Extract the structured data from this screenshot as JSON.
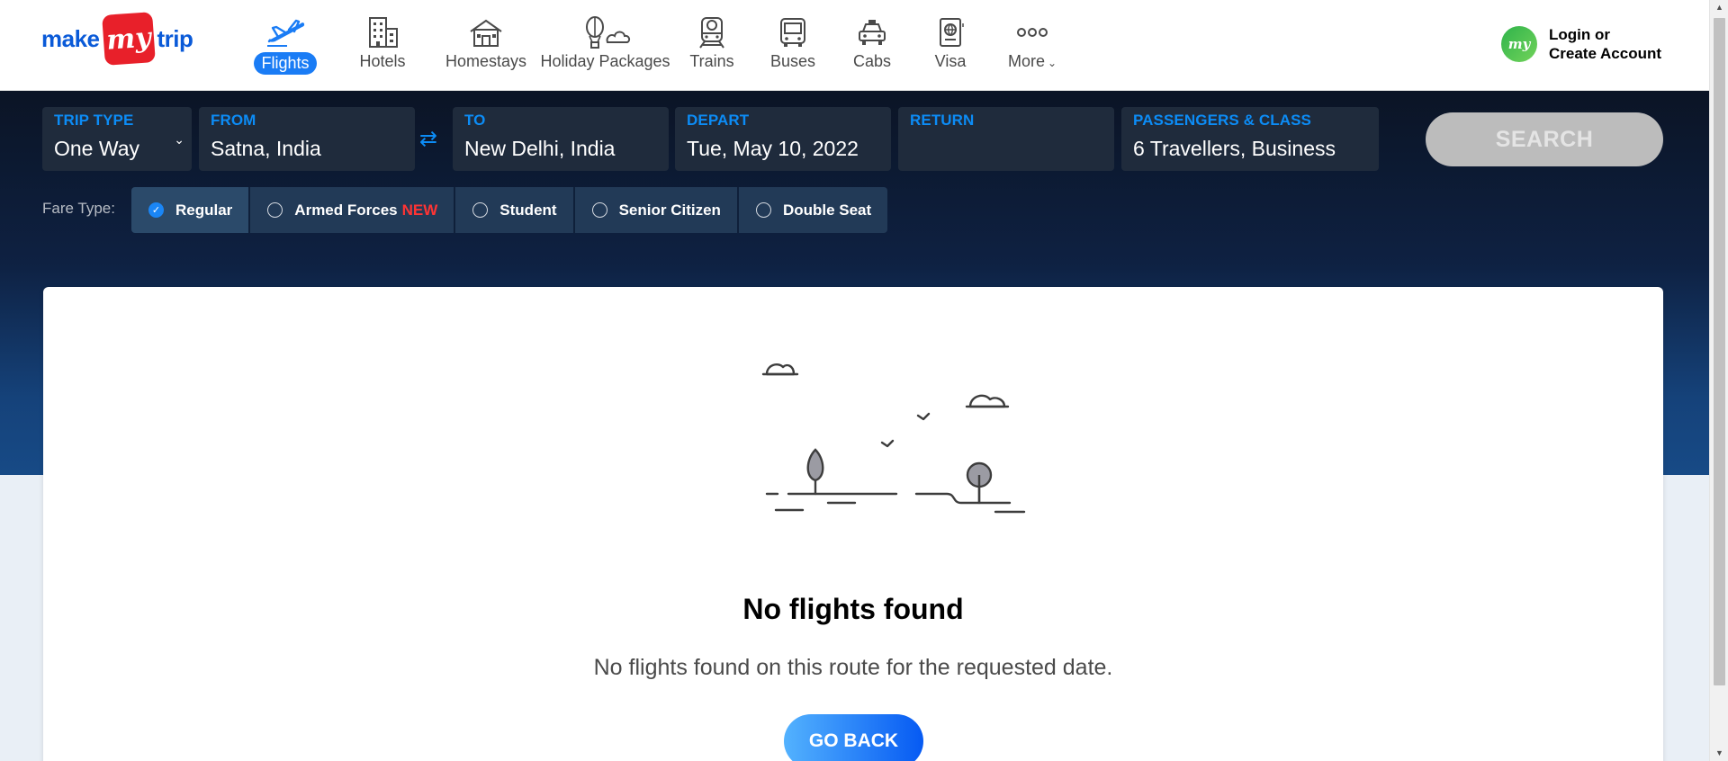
{
  "brand": {
    "make": "make",
    "my": "my",
    "trip": "trip"
  },
  "nav": [
    {
      "label": "Flights",
      "icon": "plane-icon",
      "active": true
    },
    {
      "label": "Hotels",
      "icon": "hotel-building-icon"
    },
    {
      "label": "Homestays",
      "icon": "house-icon"
    },
    {
      "label": "Holiday Packages",
      "icon": "hot-air-balloon-icon"
    },
    {
      "label": "Trains",
      "icon": "train-icon"
    },
    {
      "label": "Buses",
      "icon": "bus-icon"
    },
    {
      "label": "Cabs",
      "icon": "car-icon"
    },
    {
      "label": "Visa",
      "icon": "passport-icon"
    },
    {
      "label": "More",
      "icon": "more-dots-icon"
    }
  ],
  "login": {
    "avatar": "my",
    "line1": "Login or",
    "line2": "Create Account"
  },
  "search": {
    "trip_type": {
      "label": "TRIP TYPE",
      "value": "One Way"
    },
    "from": {
      "label": "FROM",
      "value": "Satna, India"
    },
    "to": {
      "label": "TO",
      "value": "New Delhi, India"
    },
    "depart": {
      "label": "DEPART",
      "value": "Tue, May 10, 2022"
    },
    "return": {
      "label": "RETURN",
      "value": ""
    },
    "passengers": {
      "label": "PASSENGERS & CLASS",
      "value": "6 Travellers, Business"
    },
    "swap_glyph": "⇄",
    "button": "SEARCH"
  },
  "fare": {
    "label": "Fare Type:",
    "options": [
      {
        "label": "Regular",
        "selected": true
      },
      {
        "label": "Armed Forces",
        "tag": "NEW"
      },
      {
        "label": "Student"
      },
      {
        "label": "Senior Citizen"
      },
      {
        "label": "Double Seat"
      }
    ]
  },
  "result": {
    "title": "No flights found",
    "subtitle": "No flights found on this route for the requested date.",
    "button": "GO BACK"
  },
  "colors": {
    "brand_blue": "#0a5ad8",
    "brand_red": "#e8202a",
    "accent_blue": "#0c8cf6",
    "band_dark": "#0b1425",
    "band_light": "#174a86",
    "new_tag": "#ff3434"
  }
}
